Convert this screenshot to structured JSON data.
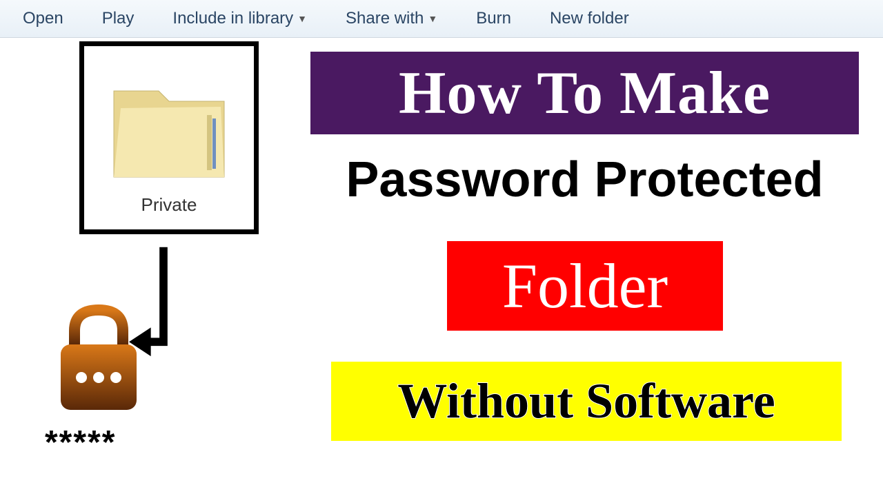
{
  "toolbar": {
    "open": "Open",
    "play": "Play",
    "include_in_library": "Include in library",
    "share_with": "Share with",
    "burn": "Burn",
    "new_folder": "New folder"
  },
  "folder": {
    "label": "Private"
  },
  "password_mask": "*****",
  "titles": {
    "line1": "How To Make",
    "line2": "Password Protected",
    "line3": "Folder",
    "line4": "Without Software"
  },
  "colors": {
    "banner1_bg": "#4a1961",
    "banner3_bg": "#ff0000",
    "banner4_bg": "#ffff00"
  }
}
